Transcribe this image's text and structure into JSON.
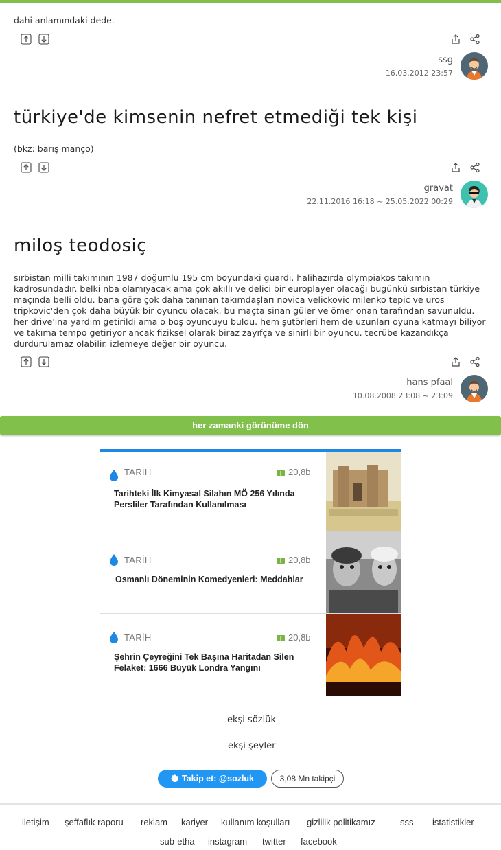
{
  "entries": [
    {
      "text": "dahi anlamındaki dede.",
      "author": "ssg",
      "date": "16.03.2012 23:57"
    },
    {
      "topic": "türkiye'de kimsenin nefret etmediği tek kişi",
      "text": "(bkz: barış manço)",
      "author": "gravat",
      "date": "22.11.2016 16:18 ~ 25.05.2022 00:29"
    },
    {
      "topic": "miloş teodosiç",
      "text": "sırbistan milli takımının 1987 doğumlu 195 cm boyundaki guardı. halihazırda olympiakos takımın kadrosundadır. belki nba olamıyacak ama çok akıllı ve delici bir europlayer olacağı bugünkü sırbistan türkiye maçında belli oldu. bana göre çok daha tanınan takımdaşları novica velickovic milenko tepic ve uros tripkovic'den çok daha büyük bir oyuncu olacak. bu maçta sinan güler ve ömer onan tarafından savunuldu. her drive'ına yardım getirildi ama o boş oyuncuyu buldu. hem şutörleri hem de uzunları oyuna katmayı biliyor ve takıma tempo getiriyor ancak fiziksel olarak biraz zayıfça ve sinirli bir oyuncu. tecrübe kazandıkça durdurulamaz olabilir. izlemeye değer bir oyuncu.",
      "author": "hans pfaal",
      "date": "10.08.2008 23:08 ~ 23:09"
    }
  ],
  "back_label": "her zamanki görünüme dön",
  "promo_cards": [
    {
      "category": "TARİH",
      "count": "20,8b",
      "title": "Tarihteki İlk Kimyasal Silahın MÖ 256 Yılında Persliler Tarafından Kullanılması"
    },
    {
      "category": "TARİH",
      "count": "20,8b",
      "title": "Osmanlı Döneminin Komedyenleri: Meddahlar"
    },
    {
      "category": "TARİH",
      "count": "20,8b",
      "title": "Şehrin Çeyreğini Tek Başına Haritadan Silen Felaket: 1666 Büyük Londra Yangını"
    }
  ],
  "site_links": {
    "eksi_sozluk": "ekşi sözlük",
    "eksi_seyler": "ekşi şeyler"
  },
  "follow": {
    "label": "Takip et: @sozluk",
    "count": "3,08 Mn takipçi"
  },
  "footer": {
    "row1": [
      "iletişim",
      "şeffaflık raporu",
      "reklam",
      "kariyer",
      "kullanım koşulları",
      "gizlilik politikamız",
      "sss",
      "istatistikler"
    ],
    "row2": [
      "sub-etha",
      "instagram",
      "twitter",
      "facebook"
    ]
  },
  "colors": {
    "accent_green": "#81c14b",
    "promo_blue": "#1e88e5",
    "follow_blue": "#2196f3"
  },
  "icons": [
    "upvote-icon",
    "downvote-icon",
    "share-out-icon",
    "share-icon",
    "water-drop-icon",
    "book-icon"
  ]
}
